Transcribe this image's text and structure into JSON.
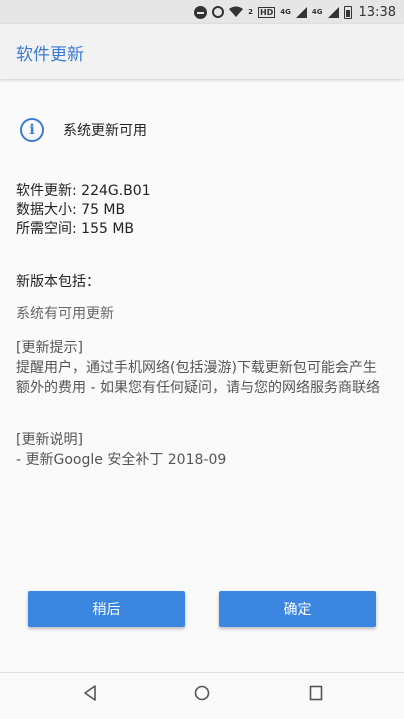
{
  "status_bar": {
    "time": "13:38",
    "signal_label_1": "4G",
    "signal_label_2": "4G",
    "hd_label": "HD",
    "sim_label": "2",
    "icons": [
      "do-not-disturb-icon",
      "alarm-icon",
      "wifi-icon",
      "signal-icon",
      "battery-icon"
    ]
  },
  "appbar": {
    "title": "软件更新"
  },
  "update": {
    "status": "系统更新可用",
    "software_version": "软件更新: 224G.B01",
    "data_size": "数据大小: 75 MB",
    "required_space": "所需空间: 155 MB"
  },
  "whats_new": {
    "heading": "新版本包括：",
    "summary": "系统有可用更新"
  },
  "notice": {
    "heading": "[更新提示]",
    "body": "提醒用户，通过手机网络(包括漫游)下载更新包可能会产生额外的费用 - 如果您有任何疑问，请与您的网络服务商联络"
  },
  "notes": {
    "heading": "[更新说明]",
    "item": "- 更新Google 安全补丁 2018-09"
  },
  "buttons": {
    "later": "稍后",
    "confirm": "确定"
  },
  "colors": {
    "accent": "#3a7bd5",
    "button": "#3a86e0"
  }
}
